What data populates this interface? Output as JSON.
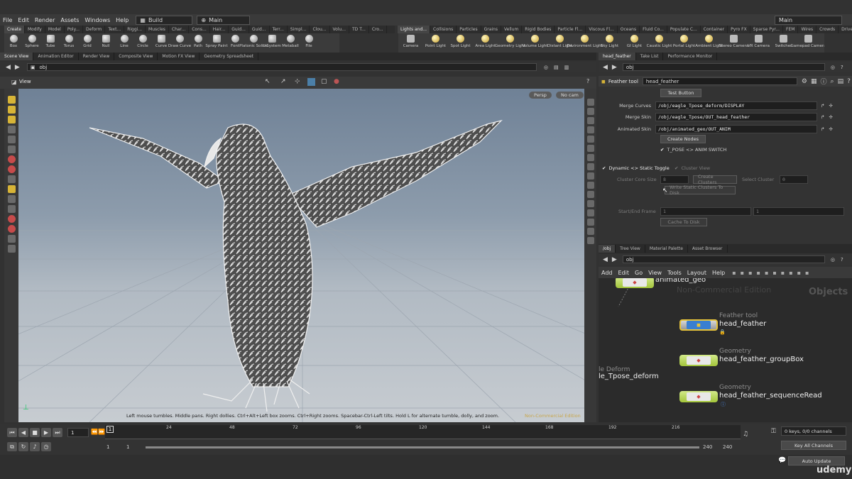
{
  "menu": {
    "items": [
      "File",
      "Edit",
      "Render",
      "Assets",
      "Windows",
      "Help"
    ],
    "desktop": "Build",
    "main": "Main",
    "right_main": "Main"
  },
  "shelf": {
    "tabs": [
      "Create",
      "Modify",
      "Model",
      "Poly...",
      "Deform",
      "Text...",
      "Riggi...",
      "Muscles",
      "Char...",
      "Cons...",
      "Hair...",
      "Guid...",
      "Guid...",
      "Terr...",
      "Simpl...",
      "Clou...",
      "Volu...",
      "TD T...",
      "Cro..."
    ],
    "right_tabs": [
      "Lights and...",
      "Collisions",
      "Particles",
      "Grains",
      "Vellum",
      "Rigid Bodies",
      "Particle Fl...",
      "Viscous Fl...",
      "Oceans",
      "Fluid Co...",
      "Populate C...",
      "Container",
      "Pyro FX",
      "Sparse Pyr...",
      "FEM",
      "Wires",
      "Crowds",
      "Drive Sim..."
    ],
    "tools": [
      "Box",
      "Sphere",
      "Tube",
      "Torus",
      "Grid",
      "Null",
      "Line",
      "Circle",
      "Curve",
      "Draw Curve",
      "Path",
      "Spray Paint",
      "Font",
      "Platonic Solids",
      "L-System",
      "Metaball",
      "File"
    ],
    "light_tools": [
      "Camera",
      "Point Light",
      "Spot Light",
      "Area Light",
      "Geometry Light",
      "Volume Light",
      "Distant Light",
      "Environment Light",
      "Sky Light",
      "GI Light",
      "Caustic Light",
      "Portal Light",
      "Ambient Light",
      "Stereo Camera",
      "VR Camera",
      "Switcher",
      "Gamepad Camera"
    ]
  },
  "left_pane": {
    "tabs": [
      "Scene View",
      "Animation Editor",
      "Render View",
      "Composite View",
      "Motion FX View",
      "Geometry Spreadsheet"
    ],
    "path": "obj",
    "view_label": "View",
    "persp": "Persp",
    "cam": "No cam",
    "hint": "Left mouse tumbles. Middle pans. Right dollies. Ctrl+Alt+Left box zooms. Ctrl+Right zooms. Spacebar-Ctrl-Left tilts. Hold L for alternate tumble, dolly, and zoom.",
    "watermark": "Non-Commercial Edition"
  },
  "right_top": {
    "tabs": [
      "head_feather",
      "Take List",
      "Performance Monitor"
    ],
    "path": "obj",
    "node_type": "Feather tool",
    "node_name": "head_feather",
    "test_button": "Test Button",
    "params": [
      {
        "label": "Merge Curves",
        "value": "/obj/eagle_Tpose_deform/DISPLAY"
      },
      {
        "label": "Merge Skin",
        "value": "/obj/eagle_Tpose/OUT_head_feather"
      },
      {
        "label": "Animated Skin",
        "value": "/obj/animated_geo/OUT_ANIM"
      }
    ],
    "create_nodes": "Create Nodes",
    "tpose_switch": "T_POSE <> ANIM SWITCH",
    "dynamic_toggle": "Dynamic <> Static Toggle",
    "cluster_view": "Cluster View",
    "cluster_core_label": "Cluster Core Size",
    "cluster_core_val": "8",
    "create_clusters": "Create Clusters",
    "select_cluster": "Select Cluster",
    "select_cluster_val": "0",
    "write_static": "Write Static Clusters To Disk",
    "start_end": "Start/End Frame",
    "start_val": "1",
    "end_val": "1",
    "cache": "Cache To Disk"
  },
  "right_bottom": {
    "tabs": [
      "/obj",
      "Tree View",
      "Material Palette",
      "Asset Browser"
    ],
    "path": "obj",
    "menu": [
      "Add",
      "Edit",
      "Go",
      "View",
      "Tools",
      "Layout",
      "Help"
    ],
    "watermark": "Non-Commercial Edition",
    "context": "Objects",
    "nodes": [
      {
        "type": "",
        "name": "animated_geo"
      },
      {
        "type": "Feather tool",
        "name": "head_feather"
      },
      {
        "type": "Geometry",
        "name": "head_feather_groupBox"
      },
      {
        "type": "Geometry",
        "name": "head_feather_sequenceRead"
      },
      {
        "type": "",
        "name": "le_Tpose_deform"
      },
      {
        "type": "",
        "name": "le Deform"
      }
    ]
  },
  "timeline": {
    "frame": "1",
    "ticks": [
      "24",
      "48",
      "72",
      "96",
      "120",
      "144",
      "168",
      "192",
      "216"
    ],
    "start": "1",
    "start2": "1",
    "end": "240",
    "end2": "240",
    "keys": "0 keys, 0/0 channels",
    "key_all": "Key All Channels",
    "auto_update": "Auto Update",
    "brand": "udemy"
  }
}
